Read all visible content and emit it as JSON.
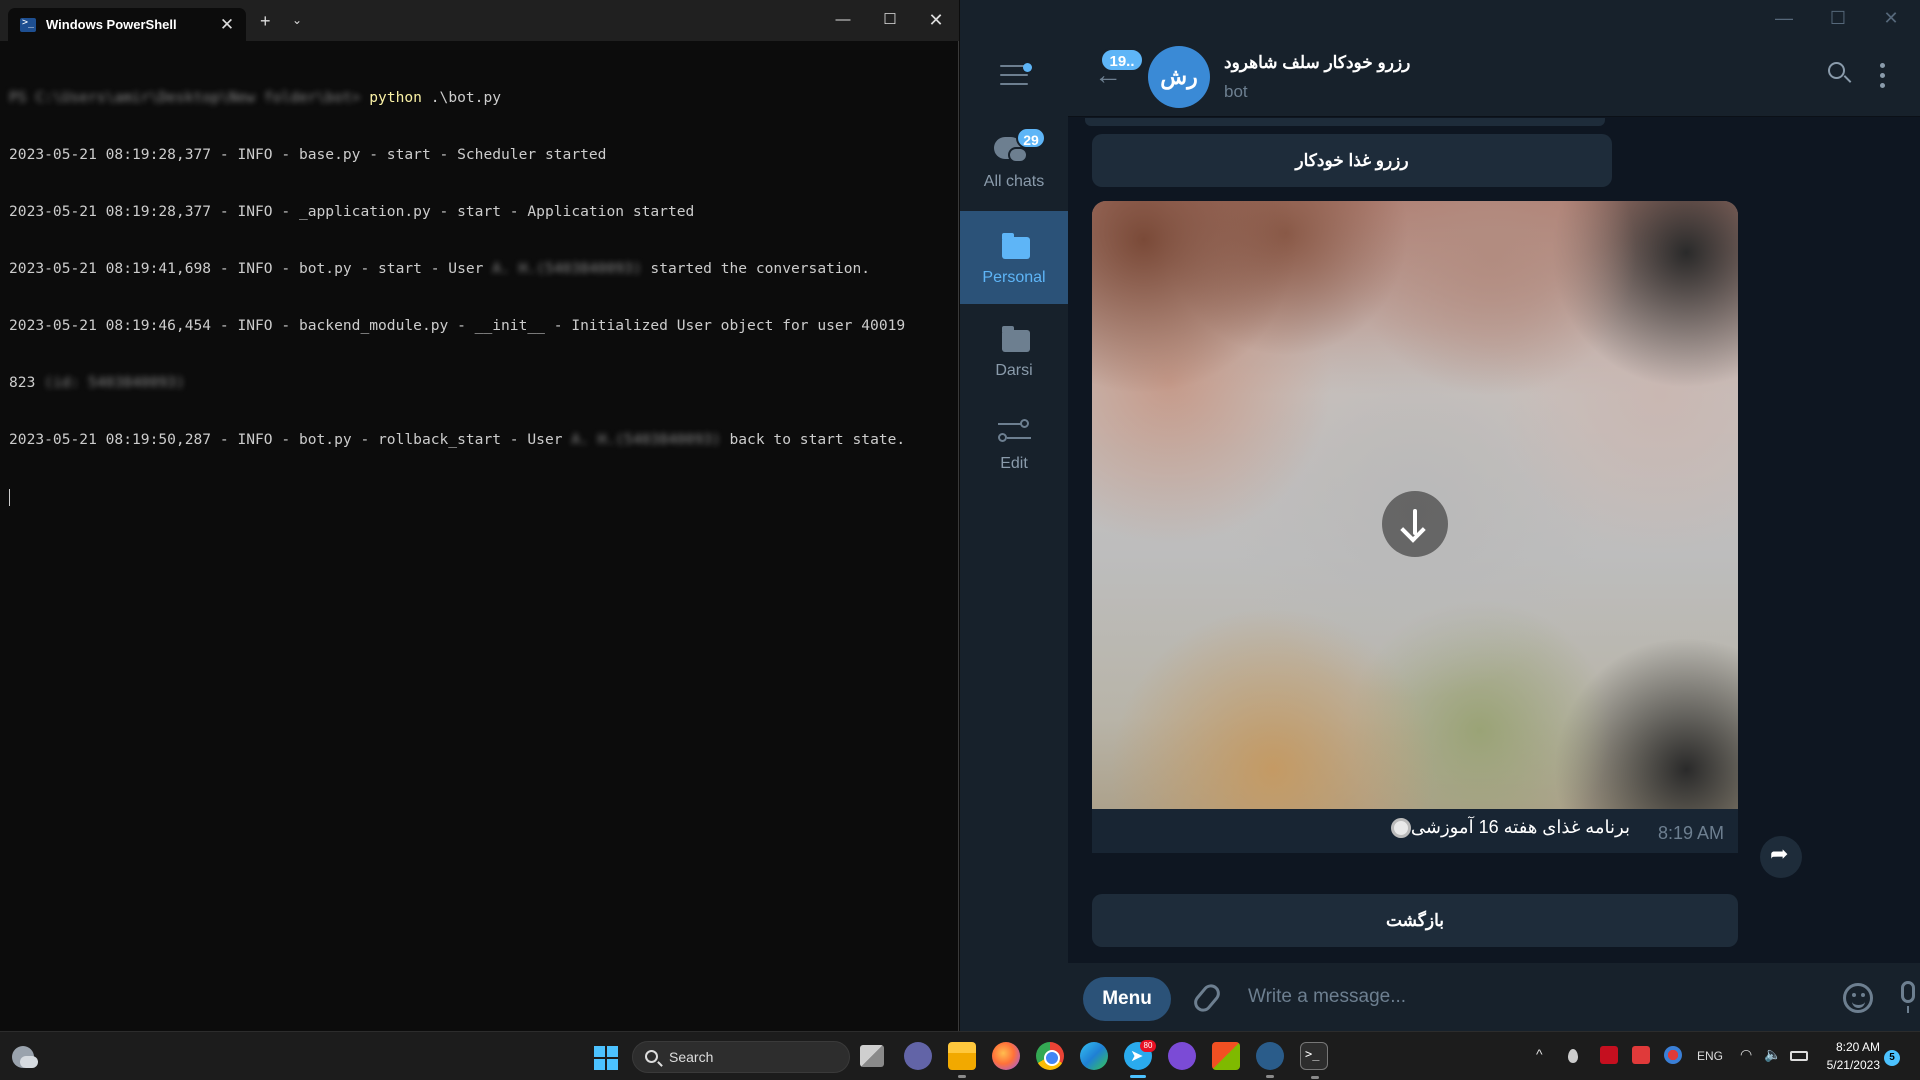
{
  "powershell": {
    "tab_title": "Windows PowerShell",
    "tab_close": "✕",
    "new_tab": "+",
    "dropdown": "⌄",
    "win_min": "—",
    "win_max": "☐",
    "win_close": "✕",
    "lines": [
      {
        "pre": "PS C:\\Users\\amir\\Desktop\\New folder\\bot>",
        "post": " .\\bot.py",
        "cmd": "python",
        "pre_blurred": true
      },
      {
        "text": "2023-05-21 08:19:28,377 - INFO - base.py - start - Scheduler started"
      },
      {
        "text": "2023-05-21 08:19:28,377 - INFO - _application.py - start - Application started"
      },
      {
        "pre": "2023-05-21 08:19:41,698 - INFO - bot.py - start - User ",
        "blur": "A. H.(5403840093)",
        "post": " started the conversation."
      },
      {
        "text": "2023-05-21 08:19:46,454 - INFO - backend_module.py - __init__ - Initialized User object for user 40019"
      },
      {
        "pre": "823 ",
        "blur": "(id: 5403840093)",
        "post": ""
      },
      {
        "pre": "2023-05-21 08:19:50,287 - INFO - bot.py - rollback_start - User ",
        "blur": "A. H.(5403840093)",
        "post": " back to start state."
      }
    ]
  },
  "telegram": {
    "win_min": "—",
    "win_max": "☐",
    "win_close": "✕",
    "folders": [
      {
        "label": "All chats",
        "badge": "29"
      },
      {
        "label": "Personal"
      },
      {
        "label": "Darsi"
      },
      {
        "label": "Edit"
      }
    ],
    "header": {
      "unread_badge": "19..",
      "avatar_initials": "رش",
      "title": "رزرو خودکار سلف شاهرود",
      "status": "bot"
    },
    "messages": {
      "keyboard_reserve": "رزرو غذا خودکار",
      "caption": "برنامه غذای هفته 16 آموزشی",
      "time": "8:19 AM",
      "keyboard_back": "بازگشت"
    },
    "compose": {
      "menu_label": "Menu",
      "placeholder": "Write a message..."
    }
  },
  "taskbar": {
    "search_label": "Search",
    "telegram_badge": "80",
    "tray_chevron": "^",
    "lang": "ENG",
    "wifi": "◠",
    "volume": "🔈",
    "time": "8:20 AM",
    "date": "5/21/2023",
    "notif_count": "5"
  }
}
